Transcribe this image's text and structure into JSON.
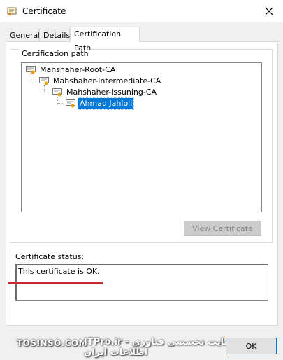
{
  "window": {
    "title": "Certificate",
    "title_icon": "certificate-icon",
    "close_icon": "close-icon"
  },
  "tabs": [
    {
      "label": "General",
      "active": false
    },
    {
      "label": "Details",
      "active": false
    },
    {
      "label": "Certification Path",
      "active": true
    }
  ],
  "certification_path": {
    "group_label": "Certification path",
    "nodes": [
      {
        "label": "Mahshaher-Root-CA",
        "level": 0,
        "selected": false
      },
      {
        "label": "Mahshaher-Intermediate-CA",
        "level": 1,
        "selected": false
      },
      {
        "label": "Mahshaher-Issuning-CA",
        "level": 2,
        "selected": false
      },
      {
        "label": "Ahmad Jahloli",
        "level": 3,
        "selected": true
      }
    ],
    "view_button_label": "View Certificate",
    "view_button_enabled": false
  },
  "status": {
    "label": "Certificate status:",
    "text": "This certificate is OK."
  },
  "footer": {
    "ok_label": "OK"
  },
  "watermark": {
    "left": "TOSINSO.COM",
    "right": "ITPro.ir - وب سایت تخصصی فناوری اطلاعات ایران"
  },
  "colors": {
    "selection": "#0078d7",
    "annotation_line": "#c8282f",
    "ok_border": "#0078d7"
  }
}
